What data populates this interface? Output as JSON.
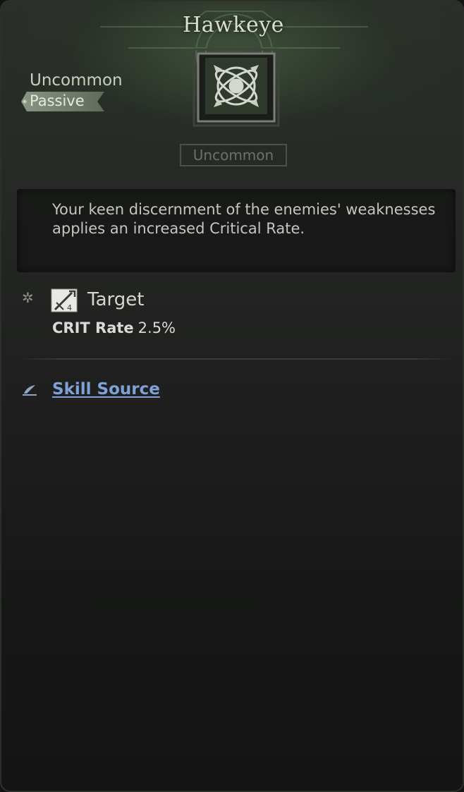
{
  "tooltip": {
    "title": "Hawkeye",
    "rarity": "Uncommon",
    "type": "Passive",
    "rarity_badge": "Uncommon",
    "description": "Your keen discernment of the enemies' weaknesses applies an increased Critical Rate.",
    "effect": {
      "label": "Target",
      "stat_name": "CRIT Rate",
      "stat_value": "2.5%"
    },
    "source_link": "Skill Source",
    "icons": {
      "skill": "compass-emblem-icon",
      "gear": "gear-icon",
      "target": "target-sword-icon",
      "source": "quill-icon"
    },
    "colors": {
      "link": "#7fa2d6",
      "accent_green": "#4e6e48"
    }
  }
}
